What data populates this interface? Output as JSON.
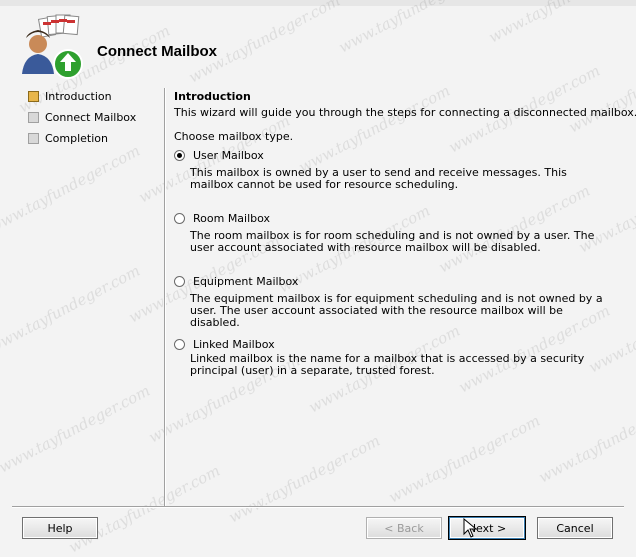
{
  "window": {
    "title": "Connect Mailbox"
  },
  "steps": [
    {
      "label": "Introduction",
      "active": true
    },
    {
      "label": "Connect Mailbox",
      "active": false
    },
    {
      "label": "Completion",
      "active": false
    }
  ],
  "content": {
    "heading": "Introduction",
    "intro": "This wizard will guide you through the steps for connecting a disconnected mailbox.",
    "choose_label": "Choose mailbox type.",
    "options": [
      {
        "label": "User Mailbox",
        "checked": true,
        "description": "This mailbox is owned by a user to send and receive messages. This mailbox cannot be used for resource scheduling."
      },
      {
        "label": "Room Mailbox",
        "checked": false,
        "description": "The room mailbox is for room scheduling and is not owned by a user. The user account associated with resource mailbox will be disabled."
      },
      {
        "label": "Equipment Mailbox",
        "checked": false,
        "description": "The equipment mailbox is for equipment scheduling and is not owned by a user. The user account associated with the resource mailbox will be disabled."
      },
      {
        "label": "Linked Mailbox",
        "checked": false,
        "description": "Linked mailbox is the name for a mailbox that is accessed by a security principal (user) in a separate, trusted forest."
      }
    ]
  },
  "buttons": {
    "help": "Help",
    "back": "< Back",
    "next": "Next >",
    "cancel": "Cancel"
  },
  "watermark": "www.tayfundeger.com",
  "colors": {
    "active_step": "#e8b64a",
    "arrow_green": "#2ea02e",
    "background": "#f3f3f3"
  }
}
